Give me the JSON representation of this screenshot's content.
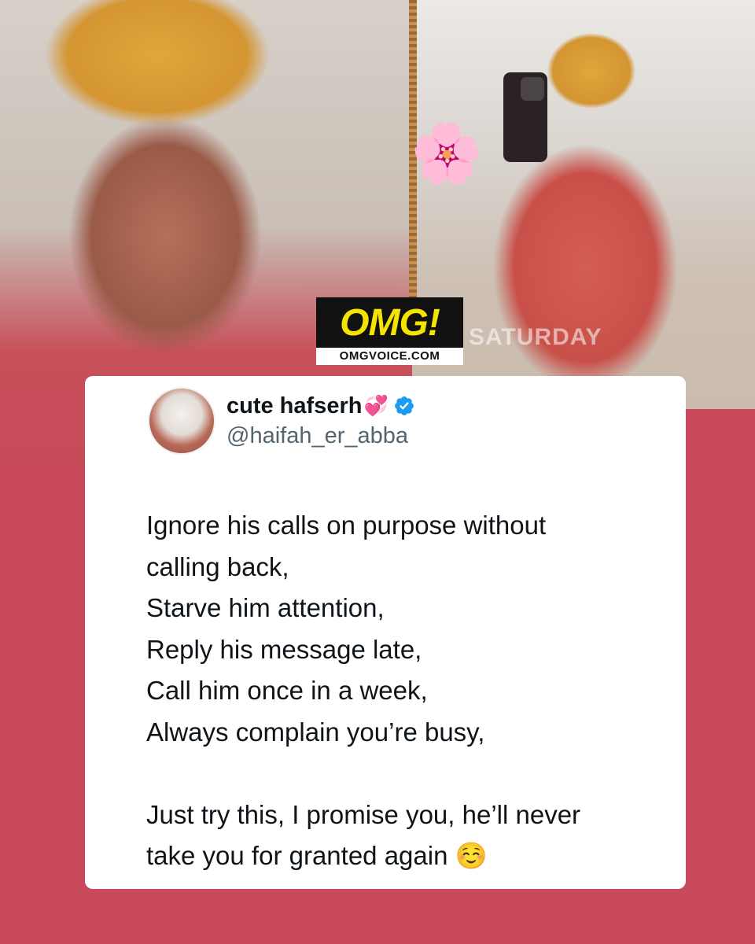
{
  "overlay": {
    "right_photo_caption": "SATURDAY",
    "flower_emoji": "🌸"
  },
  "badge": {
    "logo": "OMG!",
    "site": "OMGVOICE.COM"
  },
  "tweet": {
    "display_name": "cute hafserh",
    "name_emoji": "💞",
    "handle": "@haifah_er_abba",
    "lines": [
      "Ignore his calls on purpose without",
      "calling back,",
      "Starve him attention,",
      "Reply his message late,",
      "Call him once in a week,",
      "Always complain you’re busy,",
      "",
      "Just try this, I promise you, he’ll never",
      "take you for granted again ☺️"
    ]
  },
  "colors": {
    "background": "#c84a5a",
    "logo_yellow": "#f5e400",
    "verified_blue": "#1d9bf0"
  },
  "icons": [
    "verified-badge-icon",
    "flower-sticker-icon"
  ]
}
